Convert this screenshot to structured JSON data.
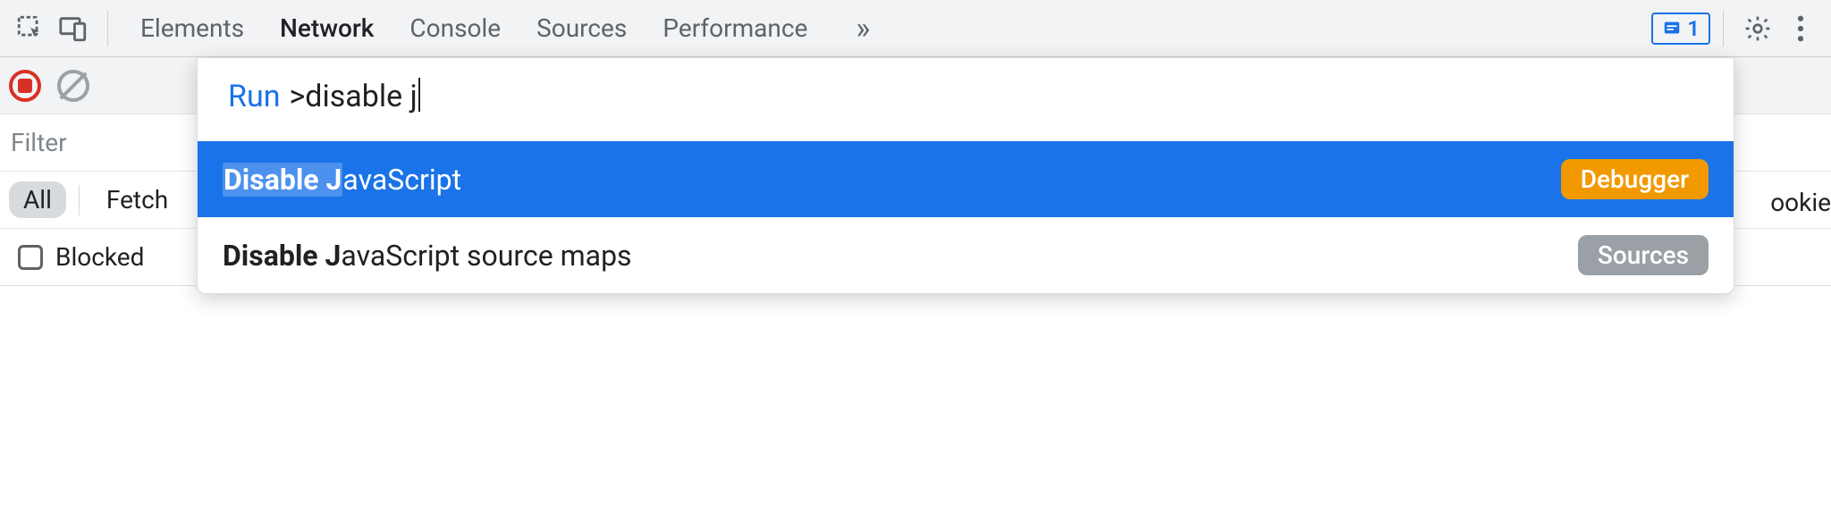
{
  "topbar": {
    "issues_count": "1",
    "tabs": [
      {
        "label": "Elements",
        "active": false
      },
      {
        "label": "Network",
        "active": true
      },
      {
        "label": "Console",
        "active": false
      },
      {
        "label": "Sources",
        "active": false
      },
      {
        "label": "Performance",
        "active": false
      }
    ]
  },
  "filter": {
    "placeholder": "Filter",
    "pills": {
      "all": "All",
      "fetch": "Fetch"
    },
    "blocked_label": "Blocked",
    "cookie_fragment": "ookie"
  },
  "palette": {
    "prefix": "Run",
    "query_prefix": ">",
    "query": "disable j",
    "items": [
      {
        "match": "Disable J",
        "rest": "avaScript",
        "panel": "Debugger",
        "panel_color": "orange",
        "selected": true
      },
      {
        "match": "Disable J",
        "rest": "avaScript source maps",
        "panel": "Sources",
        "panel_color": "gray",
        "selected": false
      }
    ]
  }
}
